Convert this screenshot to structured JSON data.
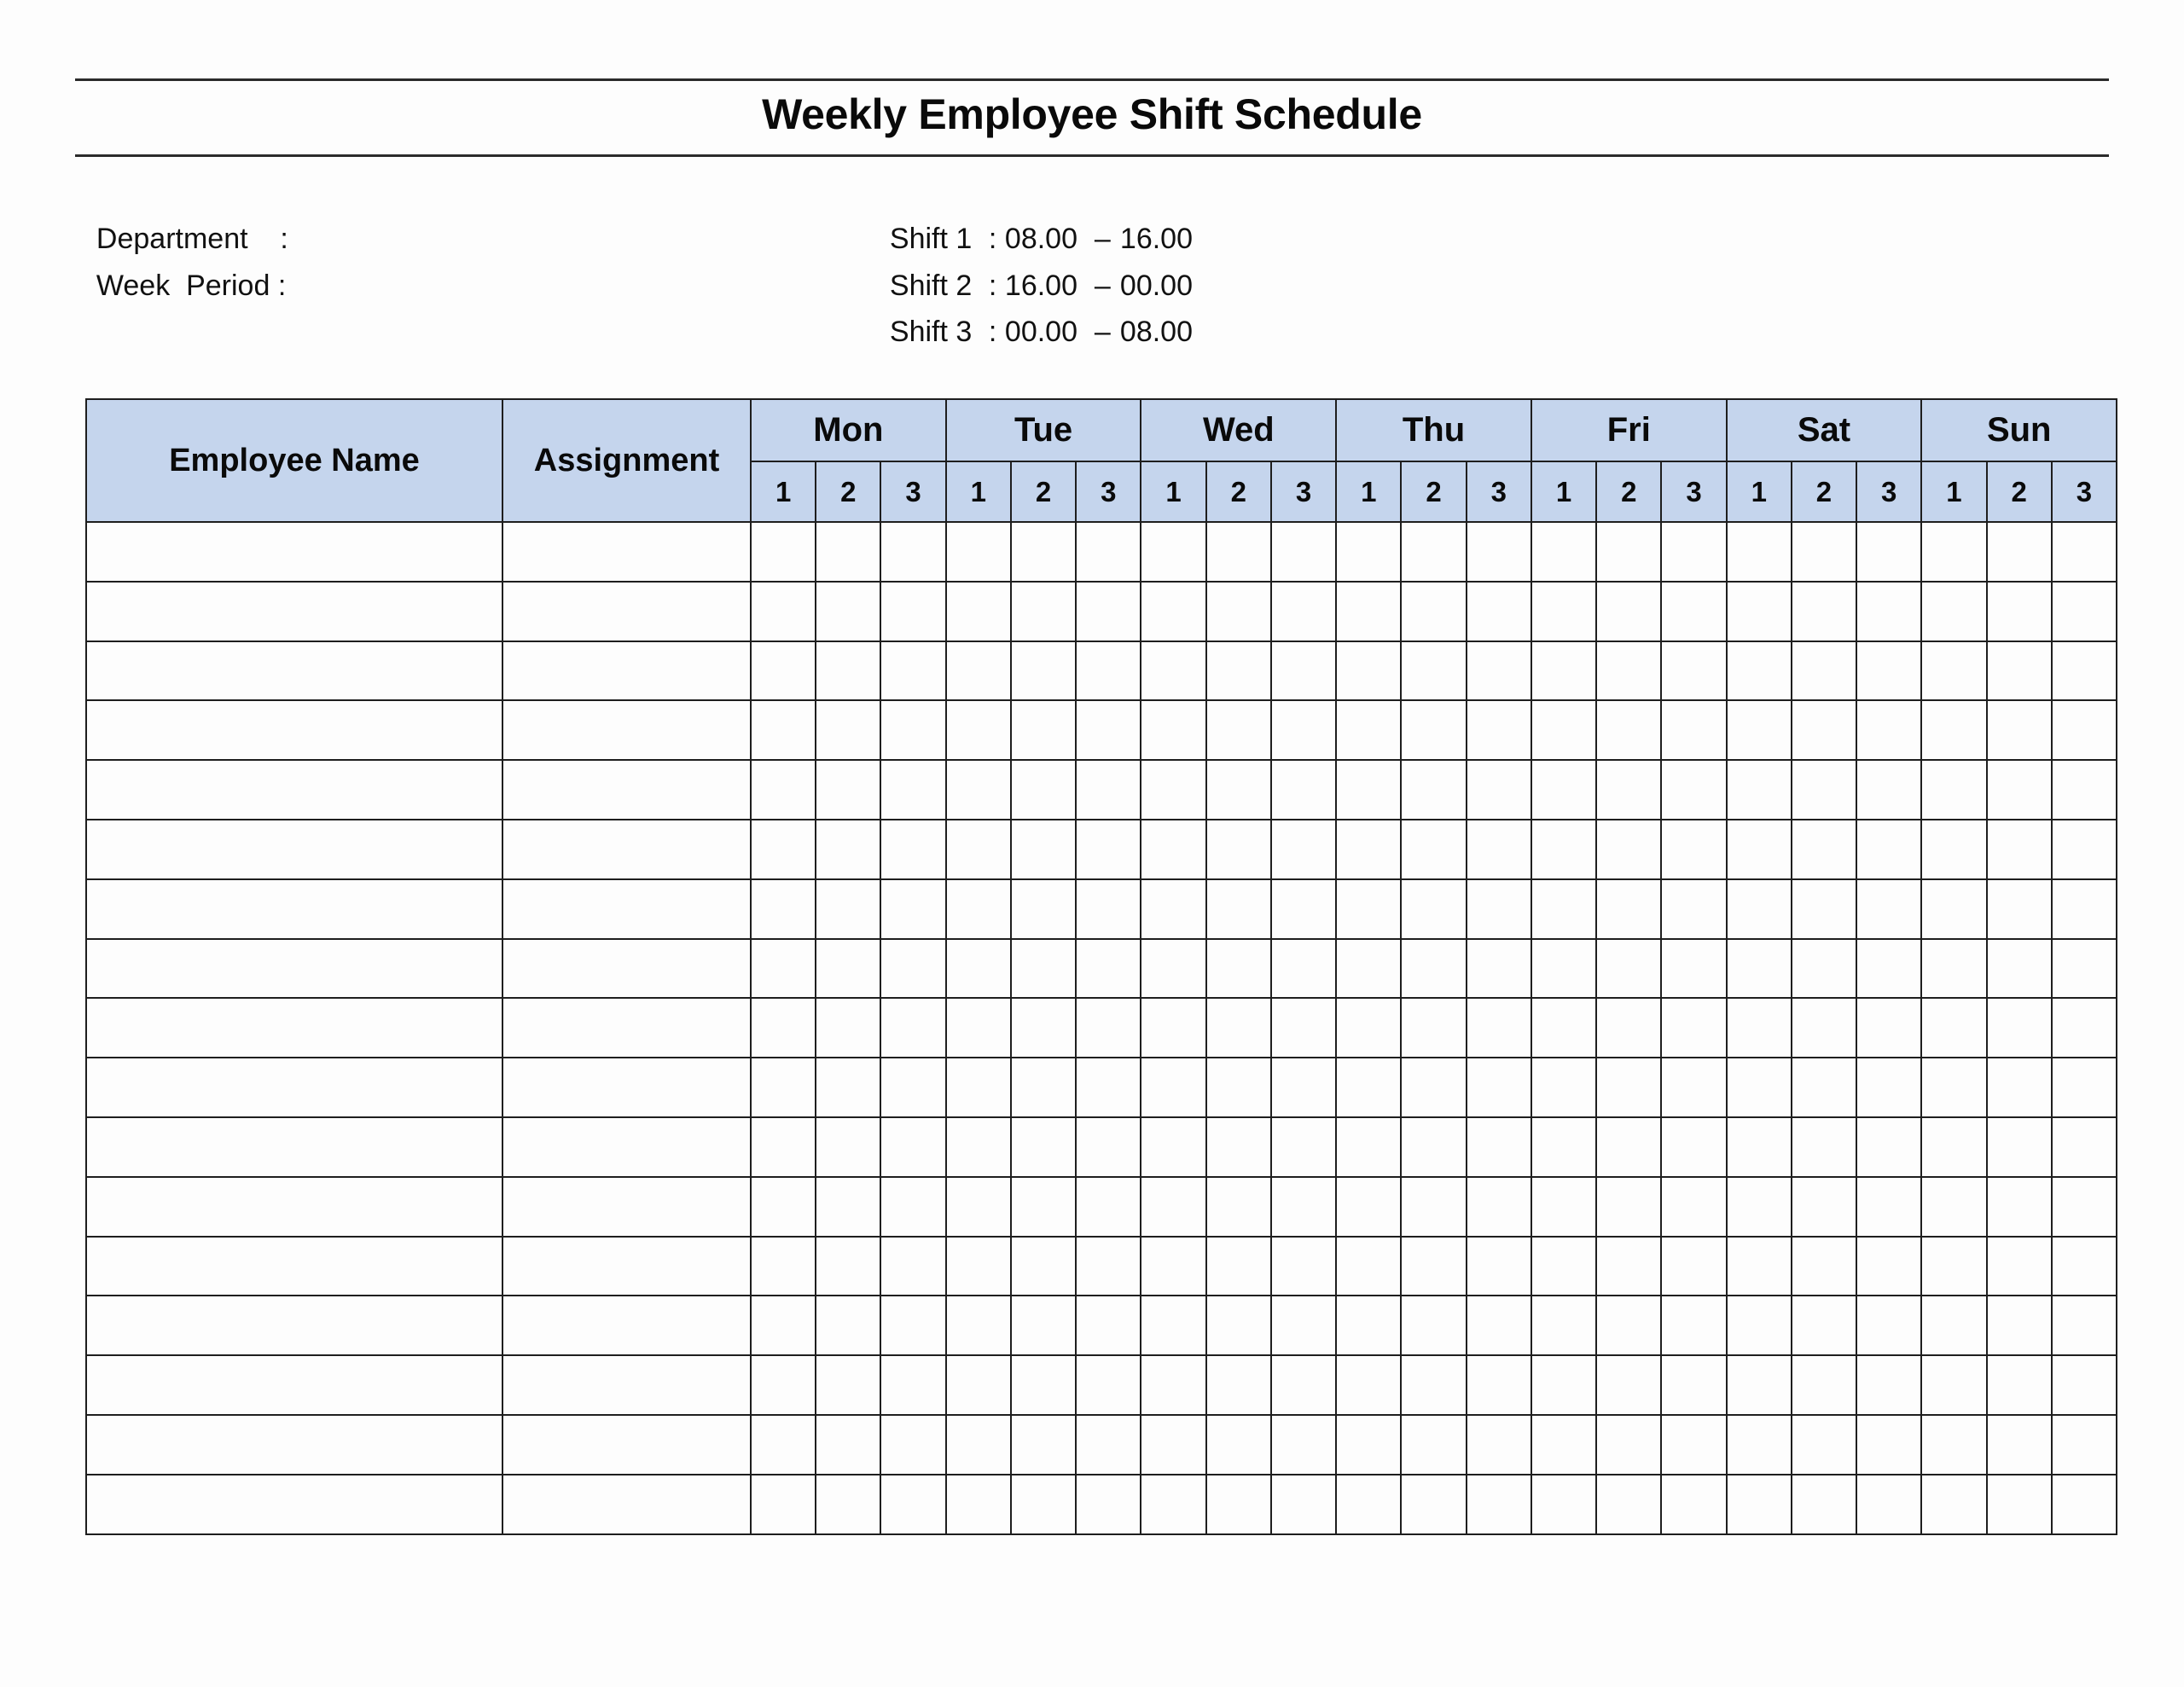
{
  "title": "Weekly Employee Shift Schedule",
  "info": {
    "department_label": "Department    :",
    "department_value": "",
    "week_period_label": "Week  Period :",
    "week_period_value": ""
  },
  "shifts": [
    {
      "label": "Shift 1",
      "start": "08.00",
      "end": "16.00"
    },
    {
      "label": "Shift 2",
      "start": "16.00",
      "end": "00.00"
    },
    {
      "label": "Shift 3",
      "start": "00.00",
      "end": "08.00"
    }
  ],
  "shift_separator": ":",
  "shift_dash": "–",
  "table": {
    "header_color": "#C5D5ED",
    "columns": {
      "employee_name": "Employee Name",
      "assignment": "Assignment"
    },
    "days": [
      "Mon",
      "Tue",
      "Wed",
      "Thu",
      "Fri",
      "Sat",
      "Sun"
    ],
    "shift_numbers": [
      "1",
      "2",
      "3"
    ],
    "rows": [
      {
        "employee_name": "",
        "assignment": "",
        "cells": [
          "",
          "",
          "",
          "",
          "",
          "",
          "",
          "",
          "",
          "",
          "",
          "",
          "",
          "",
          "",
          "",
          "",
          "",
          "",
          "",
          ""
        ]
      },
      {
        "employee_name": "",
        "assignment": "",
        "cells": [
          "",
          "",
          "",
          "",
          "",
          "",
          "",
          "",
          "",
          "",
          "",
          "",
          "",
          "",
          "",
          "",
          "",
          "",
          "",
          "",
          ""
        ]
      },
      {
        "employee_name": "",
        "assignment": "",
        "cells": [
          "",
          "",
          "",
          "",
          "",
          "",
          "",
          "",
          "",
          "",
          "",
          "",
          "",
          "",
          "",
          "",
          "",
          "",
          "",
          "",
          ""
        ]
      },
      {
        "employee_name": "",
        "assignment": "",
        "cells": [
          "",
          "",
          "",
          "",
          "",
          "",
          "",
          "",
          "",
          "",
          "",
          "",
          "",
          "",
          "",
          "",
          "",
          "",
          "",
          "",
          ""
        ]
      },
      {
        "employee_name": "",
        "assignment": "",
        "cells": [
          "",
          "",
          "",
          "",
          "",
          "",
          "",
          "",
          "",
          "",
          "",
          "",
          "",
          "",
          "",
          "",
          "",
          "",
          "",
          "",
          ""
        ]
      },
      {
        "employee_name": "",
        "assignment": "",
        "cells": [
          "",
          "",
          "",
          "",
          "",
          "",
          "",
          "",
          "",
          "",
          "",
          "",
          "",
          "",
          "",
          "",
          "",
          "",
          "",
          "",
          ""
        ]
      },
      {
        "employee_name": "",
        "assignment": "",
        "cells": [
          "",
          "",
          "",
          "",
          "",
          "",
          "",
          "",
          "",
          "",
          "",
          "",
          "",
          "",
          "",
          "",
          "",
          "",
          "",
          "",
          ""
        ]
      },
      {
        "employee_name": "",
        "assignment": "",
        "cells": [
          "",
          "",
          "",
          "",
          "",
          "",
          "",
          "",
          "",
          "",
          "",
          "",
          "",
          "",
          "",
          "",
          "",
          "",
          "",
          "",
          ""
        ]
      },
      {
        "employee_name": "",
        "assignment": "",
        "cells": [
          "",
          "",
          "",
          "",
          "",
          "",
          "",
          "",
          "",
          "",
          "",
          "",
          "",
          "",
          "",
          "",
          "",
          "",
          "",
          "",
          ""
        ]
      },
      {
        "employee_name": "",
        "assignment": "",
        "cells": [
          "",
          "",
          "",
          "",
          "",
          "",
          "",
          "",
          "",
          "",
          "",
          "",
          "",
          "",
          "",
          "",
          "",
          "",
          "",
          "",
          ""
        ]
      },
      {
        "employee_name": "",
        "assignment": "",
        "cells": [
          "",
          "",
          "",
          "",
          "",
          "",
          "",
          "",
          "",
          "",
          "",
          "",
          "",
          "",
          "",
          "",
          "",
          "",
          "",
          "",
          ""
        ]
      },
      {
        "employee_name": "",
        "assignment": "",
        "cells": [
          "",
          "",
          "",
          "",
          "",
          "",
          "",
          "",
          "",
          "",
          "",
          "",
          "",
          "",
          "",
          "",
          "",
          "",
          "",
          "",
          ""
        ]
      },
      {
        "employee_name": "",
        "assignment": "",
        "cells": [
          "",
          "",
          "",
          "",
          "",
          "",
          "",
          "",
          "",
          "",
          "",
          "",
          "",
          "",
          "",
          "",
          "",
          "",
          "",
          "",
          ""
        ]
      },
      {
        "employee_name": "",
        "assignment": "",
        "cells": [
          "",
          "",
          "",
          "",
          "",
          "",
          "",
          "",
          "",
          "",
          "",
          "",
          "",
          "",
          "",
          "",
          "",
          "",
          "",
          "",
          ""
        ]
      },
      {
        "employee_name": "",
        "assignment": "",
        "cells": [
          "",
          "",
          "",
          "",
          "",
          "",
          "",
          "",
          "",
          "",
          "",
          "",
          "",
          "",
          "",
          "",
          "",
          "",
          "",
          "",
          ""
        ]
      },
      {
        "employee_name": "",
        "assignment": "",
        "cells": [
          "",
          "",
          "",
          "",
          "",
          "",
          "",
          "",
          "",
          "",
          "",
          "",
          "",
          "",
          "",
          "",
          "",
          "",
          "",
          "",
          ""
        ]
      },
      {
        "employee_name": "",
        "assignment": "",
        "cells": [
          "",
          "",
          "",
          "",
          "",
          "",
          "",
          "",
          "",
          "",
          "",
          "",
          "",
          "",
          "",
          "",
          "",
          "",
          "",
          "",
          ""
        ]
      }
    ]
  }
}
